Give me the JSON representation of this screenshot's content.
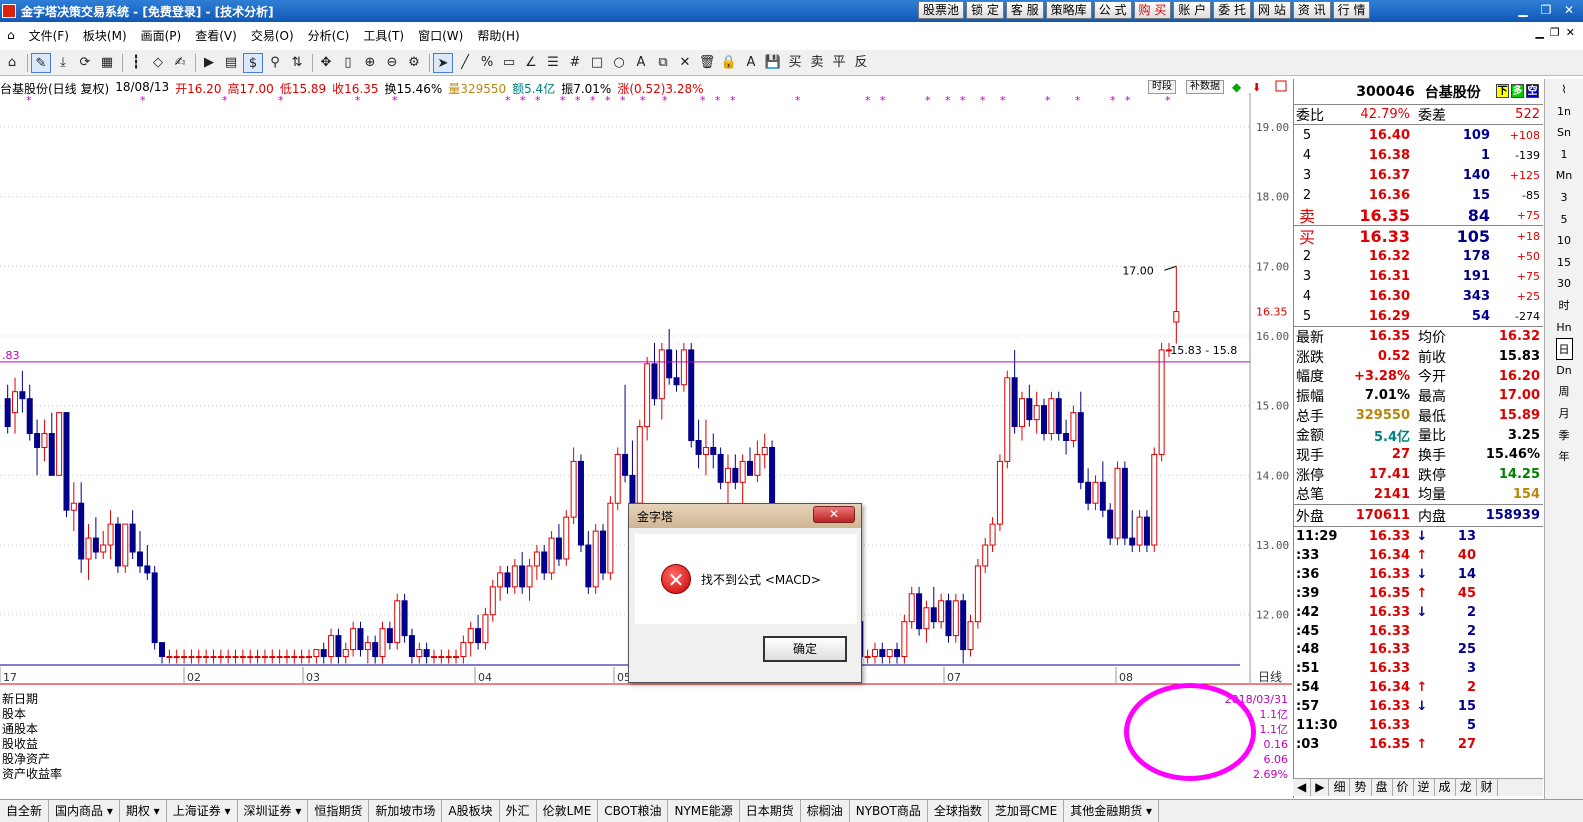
{
  "window": {
    "title": "金字塔决策交易系统 - [免费登录] - [技术分析]"
  },
  "quick_buttons": [
    "股票池",
    "锁 定",
    "客 服",
    "策略库",
    "公 式",
    "购 买",
    "账 户",
    "委 托",
    "网 站",
    "资 讯",
    "行 情"
  ],
  "menu": [
    "文件(F)",
    "板块(M)",
    "画面(P)",
    "查看(V)",
    "交易(O)",
    "分析(C)",
    "工具(T)",
    "窗口(W)",
    "帮助(H)"
  ],
  "chart_header": {
    "name": "台基股份(日线 复权)",
    "date": "18/08/13",
    "open": "开16.20",
    "high": "高17.00",
    "low": "低15.89",
    "close": "收16.35",
    "turnover": "换15.46%",
    "volume": "量329550",
    "amount": "额5.4亿",
    "amplitude": "振7.01%",
    "change": "涨(0.52)3.28%",
    "btn_seg": "时段",
    "btn_fill": "补数据"
  },
  "chart_data": {
    "type": "candlestick",
    "period_label": "日线",
    "ylim": [
      11.25,
      19.4
    ],
    "y_ticks": [
      "19.00",
      "18.00",
      "17.00",
      "16.00",
      "15.00",
      "14.00",
      "13.00",
      "12.00"
    ],
    "x_ticks": [
      "17",
      "02",
      "03",
      "04",
      "05",
      "06",
      "07",
      "08"
    ],
    "current_price": "16.35",
    "annotations": {
      "high_label": "17.00",
      "range_label": "15.83 - 15.8",
      "left_label": ".83"
    },
    "candles": [
      [
        15.1,
        15.3,
        14.6,
        14.7
      ],
      [
        14.9,
        15.4,
        14.6,
        15.2
      ],
      [
        15.2,
        15.5,
        14.9,
        15.1
      ],
      [
        15.1,
        15.3,
        14.5,
        14.6
      ],
      [
        14.6,
        14.8,
        14.0,
        14.4
      ],
      [
        14.4,
        14.8,
        14.2,
        14.6
      ],
      [
        14.6,
        14.9,
        14.0,
        14.0
      ],
      [
        14.0,
        14.9,
        14.0,
        14.9
      ],
      [
        14.9,
        14.9,
        13.4,
        13.5
      ],
      [
        13.5,
        13.9,
        13.2,
        13.6
      ],
      [
        13.6,
        13.9,
        12.6,
        12.8
      ],
      [
        12.8,
        13.3,
        12.5,
        13.1
      ],
      [
        13.1,
        13.4,
        12.8,
        12.9
      ],
      [
        12.9,
        13.2,
        12.8,
        13.0
      ],
      [
        13.0,
        13.5,
        12.8,
        13.3
      ],
      [
        13.3,
        13.4,
        12.6,
        12.7
      ],
      [
        12.7,
        13.3,
        12.6,
        13.3
      ],
      [
        13.3,
        13.5,
        12.8,
        12.9
      ],
      [
        12.9,
        13.2,
        12.6,
        12.7
      ],
      [
        12.7,
        13.0,
        12.5,
        12.6
      ],
      [
        12.6,
        12.7,
        11.5,
        11.6
      ],
      [
        11.6,
        11.6,
        11.3,
        11.4
      ],
      [
        11.4,
        11.5,
        11.3,
        11.4
      ],
      [
        11.4,
        11.5,
        11.3,
        11.4
      ],
      [
        11.4,
        11.5,
        11.3,
        11.4
      ],
      [
        11.4,
        11.5,
        11.3,
        11.4
      ],
      [
        11.4,
        11.5,
        11.3,
        11.4
      ],
      [
        11.4,
        11.5,
        11.3,
        11.4
      ],
      [
        11.4,
        11.5,
        11.3,
        11.4
      ],
      [
        11.4,
        11.5,
        11.3,
        11.4
      ],
      [
        11.4,
        11.5,
        11.3,
        11.4
      ],
      [
        11.4,
        11.5,
        11.3,
        11.4
      ],
      [
        11.4,
        11.5,
        11.3,
        11.4
      ],
      [
        11.4,
        11.5,
        11.3,
        11.4
      ],
      [
        11.4,
        11.5,
        11.3,
        11.4
      ],
      [
        11.4,
        11.5,
        11.3,
        11.4
      ],
      [
        11.4,
        11.5,
        11.3,
        11.4
      ],
      [
        11.4,
        11.5,
        11.3,
        11.4
      ],
      [
        11.4,
        11.5,
        11.3,
        11.4
      ],
      [
        11.4,
        11.5,
        11.3,
        11.4
      ],
      [
        11.4,
        11.5,
        11.3,
        11.4
      ],
      [
        11.4,
        11.5,
        11.3,
        11.4
      ],
      [
        11.4,
        11.5,
        11.3,
        11.5
      ],
      [
        11.5,
        11.6,
        11.3,
        11.4
      ],
      [
        11.4,
        11.8,
        11.3,
        11.7
      ],
      [
        11.7,
        11.8,
        11.3,
        11.4
      ],
      [
        11.4,
        11.6,
        11.3,
        11.5
      ],
      [
        11.5,
        11.9,
        11.4,
        11.8
      ],
      [
        11.8,
        11.9,
        11.4,
        11.5
      ],
      [
        11.5,
        11.7,
        11.3,
        11.6
      ],
      [
        11.6,
        11.7,
        11.3,
        11.4
      ],
      [
        11.4,
        11.9,
        11.3,
        11.8
      ],
      [
        11.8,
        11.9,
        11.5,
        11.6
      ],
      [
        11.6,
        12.3,
        11.5,
        12.2
      ],
      [
        12.2,
        12.3,
        11.6,
        11.7
      ],
      [
        11.7,
        11.8,
        11.3,
        11.4
      ],
      [
        11.4,
        11.6,
        11.3,
        11.5
      ],
      [
        11.5,
        11.6,
        11.3,
        11.4
      ],
      [
        11.4,
        11.5,
        11.3,
        11.4
      ],
      [
        11.4,
        11.5,
        11.3,
        11.4
      ],
      [
        11.4,
        11.5,
        11.3,
        11.4
      ],
      [
        11.4,
        11.5,
        11.3,
        11.4
      ],
      [
        11.4,
        11.7,
        11.3,
        11.6
      ],
      [
        11.6,
        11.9,
        11.4,
        11.8
      ],
      [
        11.8,
        12.0,
        11.5,
        11.6
      ],
      [
        11.6,
        12.1,
        11.5,
        12.0
      ],
      [
        12.0,
        12.5,
        11.9,
        12.4
      ],
      [
        12.4,
        12.7,
        12.2,
        12.6
      ],
      [
        12.6,
        12.7,
        12.3,
        12.4
      ],
      [
        12.4,
        12.8,
        12.3,
        12.7
      ],
      [
        12.7,
        12.9,
        12.3,
        12.4
      ],
      [
        12.4,
        12.8,
        12.2,
        12.7
      ],
      [
        12.7,
        13.0,
        12.5,
        12.9
      ],
      [
        12.9,
        13.0,
        12.5,
        12.6
      ],
      [
        12.6,
        13.2,
        12.5,
        13.1
      ],
      [
        13.1,
        13.3,
        12.7,
        12.8
      ],
      [
        12.8,
        13.5,
        12.7,
        13.4
      ],
      [
        13.4,
        14.4,
        13.3,
        14.2
      ],
      [
        14.2,
        14.3,
        12.9,
        13.0
      ],
      [
        13.0,
        13.2,
        12.3,
        12.4
      ],
      [
        12.4,
        13.3,
        12.3,
        13.2
      ],
      [
        13.2,
        13.3,
        12.5,
        12.6
      ],
      [
        12.6,
        13.7,
        12.5,
        13.6
      ],
      [
        13.6,
        14.4,
        13.5,
        14.3
      ],
      [
        14.3,
        15.3,
        13.9,
        14.0
      ],
      [
        14.0,
        14.5,
        13.5,
        13.6
      ],
      [
        13.6,
        14.8,
        13.5,
        14.7
      ],
      [
        14.7,
        15.7,
        14.5,
        15.6
      ],
      [
        15.6,
        15.9,
        15.0,
        15.1
      ],
      [
        15.1,
        15.9,
        14.8,
        15.8
      ],
      [
        15.8,
        16.1,
        15.3,
        15.4
      ],
      [
        15.4,
        15.8,
        15.2,
        15.3
      ],
      [
        15.3,
        15.9,
        15.2,
        15.8
      ],
      [
        15.8,
        15.9,
        14.4,
        14.5
      ],
      [
        14.5,
        14.8,
        14.1,
        14.3
      ],
      [
        14.3,
        14.8,
        14.0,
        14.4
      ],
      [
        14.4,
        14.6,
        14.1,
        14.3
      ],
      [
        14.3,
        14.4,
        13.8,
        13.9
      ],
      [
        13.9,
        14.3,
        13.5,
        14.1
      ],
      [
        14.1,
        14.3,
        13.8,
        13.9
      ],
      [
        13.9,
        14.3,
        13.6,
        14.2
      ],
      [
        14.2,
        14.4,
        14.0,
        14.0
      ],
      [
        14.0,
        14.5,
        13.9,
        14.3
      ],
      [
        14.3,
        14.6,
        14.1,
        14.4
      ],
      [
        14.4,
        14.5,
        13.0,
        13.1
      ],
      [
        13.1,
        13.3,
        12.6,
        12.7
      ],
      [
        12.7,
        12.9,
        12.2,
        12.3
      ],
      [
        12.3,
        12.5,
        11.8,
        11.9
      ],
      [
        11.9,
        12.1,
        11.5,
        11.6
      ],
      [
        11.6,
        11.8,
        11.3,
        11.4
      ],
      [
        11.4,
        11.5,
        11.3,
        11.4
      ],
      [
        11.4,
        11.5,
        11.3,
        11.4
      ],
      [
        11.4,
        11.5,
        11.3,
        11.4
      ],
      [
        11.4,
        11.5,
        11.3,
        11.4
      ],
      [
        11.4,
        11.5,
        11.3,
        11.4
      ],
      [
        11.4,
        12.0,
        11.3,
        11.9
      ],
      [
        11.9,
        12.1,
        11.3,
        11.4
      ],
      [
        11.4,
        11.5,
        11.3,
        11.4
      ],
      [
        11.4,
        11.6,
        11.3,
        11.5
      ],
      [
        11.5,
        11.6,
        11.3,
        11.4
      ],
      [
        11.4,
        11.5,
        11.3,
        11.5
      ],
      [
        11.5,
        11.6,
        11.3,
        11.4
      ],
      [
        11.4,
        12.0,
        11.3,
        11.9
      ],
      [
        11.9,
        12.4,
        11.8,
        12.3
      ],
      [
        12.3,
        12.4,
        11.7,
        11.8
      ],
      [
        11.8,
        12.2,
        11.6,
        12.1
      ],
      [
        12.1,
        12.4,
        11.8,
        11.9
      ],
      [
        11.9,
        12.3,
        11.8,
        12.2
      ],
      [
        12.2,
        12.3,
        11.6,
        11.7
      ],
      [
        11.7,
        12.3,
        11.6,
        12.2
      ],
      [
        12.2,
        12.3,
        11.3,
        11.5
      ],
      [
        11.5,
        12.0,
        11.4,
        11.9
      ],
      [
        11.9,
        12.8,
        11.8,
        12.7
      ],
      [
        12.7,
        13.1,
        12.6,
        13.0
      ],
      [
        13.0,
        13.4,
        12.9,
        13.3
      ],
      [
        13.3,
        14.3,
        13.2,
        14.2
      ],
      [
        14.2,
        15.5,
        14.1,
        15.4
      ],
      [
        15.4,
        15.8,
        14.6,
        14.7
      ],
      [
        14.7,
        15.2,
        14.5,
        15.1
      ],
      [
        15.1,
        15.3,
        14.7,
        14.8
      ],
      [
        14.8,
        15.2,
        14.6,
        15.0
      ],
      [
        15.0,
        15.1,
        14.5,
        14.6
      ],
      [
        14.6,
        15.2,
        14.5,
        15.1
      ],
      [
        15.1,
        15.2,
        14.5,
        14.6
      ],
      [
        14.6,
        14.8,
        14.3,
        14.5
      ],
      [
        14.5,
        15.0,
        14.4,
        14.9
      ],
      [
        14.9,
        15.2,
        13.8,
        13.9
      ],
      [
        13.9,
        14.1,
        13.5,
        13.6
      ],
      [
        13.6,
        14.0,
        13.5,
        13.9
      ],
      [
        13.9,
        14.2,
        13.4,
        13.5
      ],
      [
        13.5,
        13.6,
        13.0,
        13.1
      ],
      [
        13.1,
        14.2,
        13.0,
        14.1
      ],
      [
        14.1,
        14.2,
        13.0,
        13.1
      ],
      [
        13.1,
        13.5,
        12.9,
        13.0
      ],
      [
        13.0,
        13.5,
        12.9,
        13.4
      ],
      [
        13.4,
        13.5,
        12.9,
        13.0
      ],
      [
        13.0,
        14.4,
        12.9,
        14.3
      ],
      [
        14.3,
        15.9,
        14.2,
        15.8
      ],
      [
        15.8,
        15.9,
        15.7,
        15.8
      ],
      [
        16.2,
        17.0,
        15.89,
        16.35
      ]
    ]
  },
  "fin_labels": [
    "新日期",
    "股本",
    "通股本",
    "股收益",
    "股净资产",
    "资产收益率"
  ],
  "fin_values": [
    "2018/03/31",
    "1.1亿",
    "1.1亿",
    "0.16",
    "6.06",
    "2.69%"
  ],
  "stock": {
    "code": "300046",
    "name": "台基股份",
    "icons": [
      "下",
      "多",
      "空"
    ]
  },
  "weibi": {
    "label": "委比",
    "value": "42.79%",
    "label2": "委差",
    "value2": "522"
  },
  "asks": [
    {
      "lvl": "5",
      "price": "16.40",
      "qty": "109",
      "chg": "+108"
    },
    {
      "lvl": "4",
      "price": "16.38",
      "qty": "1",
      "chg": "-139"
    },
    {
      "lvl": "3",
      "price": "16.37",
      "qty": "140",
      "chg": "+125"
    },
    {
      "lvl": "2",
      "price": "16.36",
      "qty": "15",
      "chg": "-85"
    },
    {
      "lvl": "卖",
      "price": "16.35",
      "qty": "84",
      "chg": "+75"
    }
  ],
  "bids": [
    {
      "lvl": "买",
      "price": "16.33",
      "qty": "105",
      "chg": "+18"
    },
    {
      "lvl": "2",
      "price": "16.32",
      "qty": "178",
      "chg": "+50"
    },
    {
      "lvl": "3",
      "price": "16.31",
      "qty": "191",
      "chg": "+75"
    },
    {
      "lvl": "4",
      "price": "16.30",
      "qty": "343",
      "chg": "+25"
    },
    {
      "lvl": "5",
      "price": "16.29",
      "qty": "54",
      "chg": "-274"
    }
  ],
  "quote": [
    {
      "l": "最新",
      "v": "16.35",
      "c": "#d00",
      "l2": "均价",
      "v2": "16.32",
      "c2": "#d00"
    },
    {
      "l": "涨跌",
      "v": "0.52",
      "c": "#d00",
      "l2": "前收",
      "v2": "15.83",
      "c2": "#000"
    },
    {
      "l": "幅度",
      "v": "+3.28%",
      "c": "#d00",
      "l2": "今开",
      "v2": "16.20",
      "c2": "#d00"
    },
    {
      "l": "振幅",
      "v": "7.01%",
      "c": "#000",
      "l2": "最高",
      "v2": "17.00",
      "c2": "#d00"
    },
    {
      "l": "总手",
      "v": "329550",
      "c": "#b8860b",
      "l2": "最低",
      "v2": "15.89",
      "c2": "#d00"
    },
    {
      "l": "金额",
      "v": "5.4亿",
      "c": "#008080",
      "l2": "量比",
      "v2": "3.25",
      "c2": "#000"
    },
    {
      "l": "现手",
      "v": "27",
      "c": "#d00",
      "l2": "换手",
      "v2": "15.46%",
      "c2": "#000"
    },
    {
      "l": "涨停",
      "v": "17.41",
      "c": "#d00",
      "l2": "跌停",
      "v2": "14.25",
      "c2": "#008000"
    },
    {
      "l": "总笔",
      "v": "2141",
      "c": "#d00",
      "l2": "均量",
      "v2": "154",
      "c2": "#b8860b"
    }
  ],
  "waipan": {
    "l": "外盘",
    "v": "170611",
    "l2": "内盘",
    "v2": "158939"
  },
  "ticks": [
    {
      "t": "11:29",
      "p": "16.33",
      "d": "↓",
      "q": "13",
      "pc": "#d00",
      "dc": "#00008b",
      "qc": "#00008b"
    },
    {
      "t": ":33",
      "p": "16.34",
      "d": "↑",
      "q": "40",
      "pc": "#d00",
      "dc": "#d00",
      "qc": "#d00"
    },
    {
      "t": ":36",
      "p": "16.33",
      "d": "↓",
      "q": "14",
      "pc": "#d00",
      "dc": "#00008b",
      "qc": "#00008b"
    },
    {
      "t": ":39",
      "p": "16.35",
      "d": "↑",
      "q": "45",
      "pc": "#d00",
      "dc": "#d00",
      "qc": "#d00"
    },
    {
      "t": ":42",
      "p": "16.33",
      "d": "↓",
      "q": "2",
      "pc": "#d00",
      "dc": "#00008b",
      "qc": "#00008b"
    },
    {
      "t": ":45",
      "p": "16.33",
      "d": "",
      "q": "2",
      "pc": "#d00",
      "dc": "#000",
      "qc": "#00008b"
    },
    {
      "t": ":48",
      "p": "16.33",
      "d": "",
      "q": "25",
      "pc": "#d00",
      "dc": "#000",
      "qc": "#00008b"
    },
    {
      "t": ":51",
      "p": "16.33",
      "d": "",
      "q": "3",
      "pc": "#d00",
      "dc": "#000",
      "qc": "#00008b"
    },
    {
      "t": ":54",
      "p": "16.34",
      "d": "↑",
      "q": "2",
      "pc": "#d00",
      "dc": "#d00",
      "qc": "#d00"
    },
    {
      "t": ":57",
      "p": "16.33",
      "d": "↓",
      "q": "15",
      "pc": "#d00",
      "dc": "#00008b",
      "qc": "#00008b"
    },
    {
      "t": "11:30",
      "p": "16.33",
      "d": "",
      "q": "5",
      "pc": "#d00",
      "dc": "#000",
      "qc": "#00008b"
    },
    {
      "t": ":03",
      "p": "16.35",
      "d": "↑",
      "q": "27",
      "pc": "#d00",
      "dc": "#d00",
      "qc": "#d00"
    }
  ],
  "right_tabs": [
    "细",
    "势",
    "盘",
    "价",
    "逆",
    "成",
    "龙",
    "财"
  ],
  "vtabs": [
    "1n",
    "Sn",
    "1",
    "Mn",
    "3",
    "5",
    "10",
    "15",
    "30",
    "时",
    "Hn",
    "日",
    "Dn",
    "周",
    "月",
    "季",
    "年"
  ],
  "bottom_tabs": [
    "自全新",
    "国内商品 ▾",
    "期权 ▾",
    "上海证券 ▾",
    "深圳证券 ▾",
    "恒指期货",
    "新加坡市场",
    "A股板块",
    "外汇",
    "伦敦LME",
    "CBOT粮油",
    "NYME能源",
    "日本期货",
    "棕榈油",
    "NYBOT商品",
    "全球指数",
    "芝加哥CME",
    "其他金融期货 ▾"
  ],
  "dialog": {
    "title": "金字塔",
    "close": "✕",
    "icon": "✕",
    "message": "找不到公式 <MACD>",
    "ok": "确定"
  }
}
